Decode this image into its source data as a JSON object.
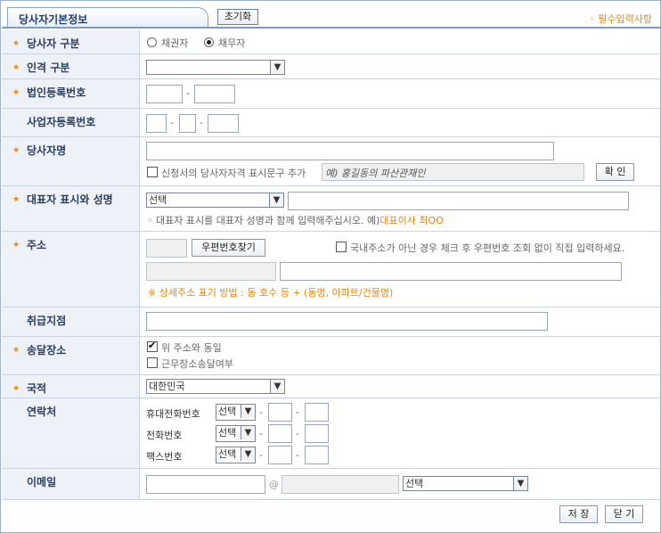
{
  "tab": {
    "title": "당사자기본정보"
  },
  "header": {
    "reset_label": "초기화",
    "required_note": "◦ 필수입력사항"
  },
  "colors": {
    "accent": "#e08a16",
    "label_bg": "#eef2f8",
    "border": "#c8d2e0"
  },
  "rows": {
    "party_type": {
      "label": "당사자 구분",
      "options": [
        "채권자",
        "채무자"
      ],
      "selected": "채무자"
    },
    "person_type": {
      "label": "인격 구분",
      "value": ""
    },
    "corp_reg_no": {
      "label": "법인등록번호",
      "sep": "-"
    },
    "biz_reg_no": {
      "label": "사업자등록번호",
      "sep": "-"
    },
    "party_name": {
      "label": "당사자명",
      "addon_check": "신청서의 당사자자격 표시문구 추가",
      "addon_placeholder": "예) 홍길동의 파산관재인",
      "confirm": "확 인"
    },
    "representative": {
      "label": "대표자 표시와 성명",
      "select": "선택",
      "hint": "◦ 대표자 표시를 대표자 성명과 함께 입력해주십시오. 예)",
      "hint_example": "대표이사 최OO"
    },
    "address": {
      "label": "주소",
      "zip_button": "우편번호찾기",
      "foreign_check": "국내주소가 아닌 경우 체크 후 우편번호 조회 없이 직접 입력하세요.",
      "note": "※ 상세주소 표기 방법 : 동 호수 등 + (동명, 아파트/건물명)"
    },
    "branch": {
      "label": "취급지점"
    },
    "delivery": {
      "label": "송달장소",
      "same_as": "위 주소와 동일",
      "workplace": "근무장소송달여부",
      "same_checked": true
    },
    "nationality": {
      "label": "국적",
      "value": "대한민국"
    },
    "contact": {
      "label": "연락처",
      "lines": [
        {
          "name": "휴대전화번호",
          "select": "선택"
        },
        {
          "name": "전화번호",
          "select": "선택"
        },
        {
          "name": "팩스번호",
          "select": "선택"
        }
      ],
      "sep": "-"
    },
    "email": {
      "label": "이메일",
      "at": "@",
      "select": "선택"
    }
  },
  "footer": {
    "save_label": "저 장",
    "close_label": "닫 기"
  }
}
